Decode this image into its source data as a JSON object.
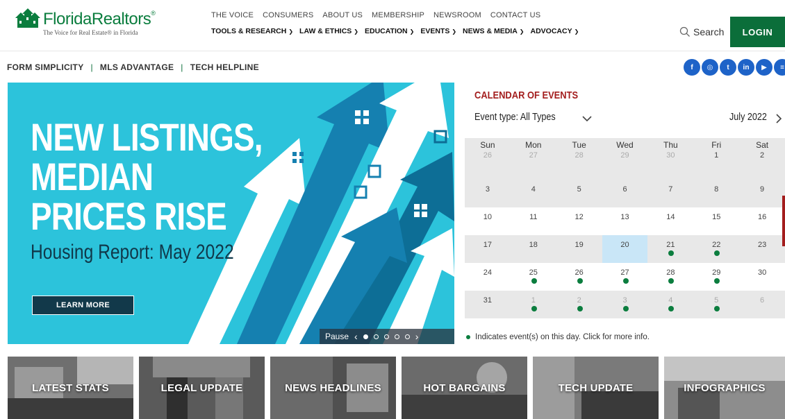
{
  "brand": {
    "name": "FloridaRealtors",
    "tagline": "The Voice for Real Estate® in Florida",
    "green": "#0b6e3a"
  },
  "top_links": [
    "THE VOICE",
    "CONSUMERS",
    "ABOUT US",
    "MEMBERSHIP",
    "NEWSROOM",
    "CONTACT US"
  ],
  "main_nav": [
    "TOOLS & RESEARCH",
    "LAW & ETHICS",
    "EDUCATION",
    "EVENTS",
    "NEWS & MEDIA",
    "ADVOCACY"
  ],
  "search_label": "Search",
  "login_label": "LOGIN",
  "sub_nav": [
    "FORM SIMPLICITY",
    "MLS ADVANTAGE",
    "TECH HELPLINE"
  ],
  "sub_nav_sep": "|",
  "social_icons": [
    {
      "name": "facebook-icon",
      "glyph": "f"
    },
    {
      "name": "instagram-icon",
      "glyph": "◎"
    },
    {
      "name": "twitter-icon",
      "glyph": "t"
    },
    {
      "name": "linkedin-icon",
      "glyph": "in"
    },
    {
      "name": "youtube-icon",
      "glyph": "▶"
    },
    {
      "name": "rss-icon",
      "glyph": "≡"
    }
  ],
  "hero": {
    "title_line1": "NEW LISTINGS,",
    "title_line2": "MEDIAN",
    "title_line3": "PRICES RISE",
    "subtitle": "Housing Report: May 2022",
    "button": "LEARN MORE",
    "pause_label": "Pause",
    "prev": "‹",
    "next": "›",
    "slide_count": 5,
    "active_slide": 1
  },
  "calendar": {
    "title": "CALENDAR OF EVENTS",
    "event_type": "Event type: All Types",
    "month": "July 2022",
    "days": [
      "Sun",
      "Mon",
      "Tue",
      "Wed",
      "Thu",
      "Fri",
      "Sat"
    ],
    "weeks": [
      [
        {
          "d": "26",
          "m": true
        },
        {
          "d": "27",
          "m": true
        },
        {
          "d": "28",
          "m": true
        },
        {
          "d": "29",
          "m": true
        },
        {
          "d": "30",
          "m": true
        },
        {
          "d": "1"
        },
        {
          "d": "2"
        }
      ],
      [
        {
          "d": "3"
        },
        {
          "d": "4"
        },
        {
          "d": "5"
        },
        {
          "d": "6"
        },
        {
          "d": "7"
        },
        {
          "d": "8"
        },
        {
          "d": "9"
        }
      ],
      [
        {
          "d": "10"
        },
        {
          "d": "11"
        },
        {
          "d": "12"
        },
        {
          "d": "13"
        },
        {
          "d": "14"
        },
        {
          "d": "15"
        },
        {
          "d": "16"
        }
      ],
      [
        {
          "d": "17"
        },
        {
          "d": "18"
        },
        {
          "d": "19"
        },
        {
          "d": "20",
          "today": true
        },
        {
          "d": "21",
          "ev": true
        },
        {
          "d": "22",
          "ev": true
        },
        {
          "d": "23"
        }
      ],
      [
        {
          "d": "24"
        },
        {
          "d": "25",
          "ev": true
        },
        {
          "d": "26",
          "ev": true
        },
        {
          "d": "27",
          "ev": true
        },
        {
          "d": "28",
          "ev": true
        },
        {
          "d": "29",
          "ev": true
        },
        {
          "d": "30"
        }
      ],
      [
        {
          "d": "31"
        },
        {
          "d": "1",
          "m": true,
          "ev": true
        },
        {
          "d": "2",
          "m": true,
          "ev": true
        },
        {
          "d": "3",
          "m": true,
          "ev": true
        },
        {
          "d": "4",
          "m": true,
          "ev": true
        },
        {
          "d": "5",
          "m": true,
          "ev": true
        },
        {
          "d": "6",
          "m": true
        }
      ]
    ],
    "legend": "Indicates event(s) on this day. Click for more info."
  },
  "tiles": [
    "LATEST STATS",
    "LEGAL UPDATE",
    "NEWS HEADLINES",
    "HOT BARGAINS",
    "TECH UPDATE",
    "INFOGRAPHICS"
  ]
}
